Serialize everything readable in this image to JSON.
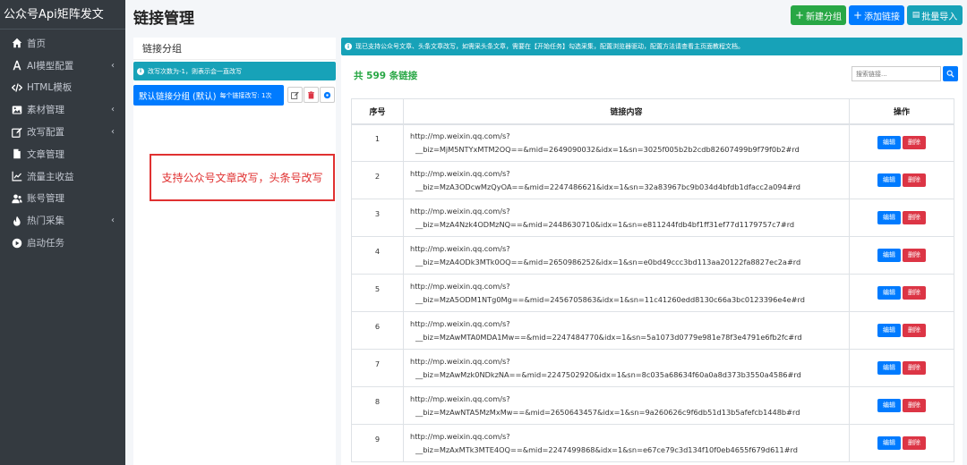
{
  "sidebar": {
    "brand": "公众号Api矩阵发文",
    "items": [
      {
        "label": "首页",
        "icon": "home-icon",
        "chevron": false
      },
      {
        "label": "AI模型配置",
        "icon": "ai-font-icon",
        "chevron": true
      },
      {
        "label": "HTML模板",
        "icon": "code-icon",
        "chevron": false
      },
      {
        "label": "素材管理",
        "icon": "image-icon",
        "chevron": true
      },
      {
        "label": "改写配置",
        "icon": "edit-icon",
        "chevron": true
      },
      {
        "label": "文章管理",
        "icon": "file-icon",
        "chevron": false
      },
      {
        "label": "流量主收益",
        "icon": "chart-line-icon",
        "chevron": false
      },
      {
        "label": "账号管理",
        "icon": "users-icon",
        "chevron": false
      },
      {
        "label": "热门采集",
        "icon": "fire-icon",
        "chevron": true
      },
      {
        "label": "启动任务",
        "icon": "play-circle-icon",
        "chevron": false
      }
    ]
  },
  "header": {
    "title": "链接管理",
    "buttons": {
      "new_group": "新建分组",
      "add_link": "添加链接",
      "bulk_import": "批量导入"
    }
  },
  "group_panel": {
    "title": "链接分组",
    "alert": "改写次数为-1，则表示会一直改写",
    "group": {
      "name": "默认链接分组 (默认)",
      "count_text": "每个链接改写: 1次"
    }
  },
  "annotation": "支持公众号文章改写，头条号改写",
  "main": {
    "alert": "现已支持公众号文章、头条文章改写，如需采头条文章，需要在【开始任务】勾选采集，配置浏览器驱动，配置方法请查看主页面教程文档。",
    "count": "共 599 条链接",
    "search_placeholder": "搜索链接...",
    "table": {
      "headers": [
        "序号",
        "链接内容",
        "操作"
      ],
      "edit_label": "编辑",
      "delete_label": "删除",
      "rows": [
        {
          "no": "1",
          "line1": "http://mp.weixin.qq.com/s?",
          "line2": "__biz=MjM5NTYxMTM2OQ==&mid=2649090032&idx=1&sn=3025f005b2b2cdb82607499b9f79f0b2#rd"
        },
        {
          "no": "2",
          "line1": "http://mp.weixin.qq.com/s?",
          "line2": "__biz=MzA3ODcwMzQyOA==&mid=2247486621&idx=1&sn=32a83967bc9b034d4bfdb1dfacc2a094#rd"
        },
        {
          "no": "3",
          "line1": "http://mp.weixin.qq.com/s?",
          "line2": "__biz=MzA4Nzk4ODMzNQ==&mid=2448630710&idx=1&sn=e811244fdb4bf1ff31ef77d1179757c7#rd"
        },
        {
          "no": "4",
          "line1": "http://mp.weixin.qq.com/s?",
          "line2": "__biz=MzA4ODk3MTk0OQ==&mid=2650986252&idx=1&sn=e0bd49ccc3bd113aa20122fa8827ec2a#rd"
        },
        {
          "no": "5",
          "line1": "http://mp.weixin.qq.com/s?",
          "line2": "__biz=MzA5ODM1NTg0Mg==&mid=2456705863&idx=1&sn=11c41260edd8130c66a3bc0123396e4e#rd"
        },
        {
          "no": "6",
          "line1": "http://mp.weixin.qq.com/s?",
          "line2": "__biz=MzAwMTA0MDA1Mw==&mid=2247484770&idx=1&sn=5a1073d0779e981e78f3e4791e6fb2fc#rd"
        },
        {
          "no": "7",
          "line1": "http://mp.weixin.qq.com/s?",
          "line2": "__biz=MzAwMzk0NDkzNA==&mid=2247502920&idx=1&sn=8c035a68634f60a0a8d373b3550a4586#rd"
        },
        {
          "no": "8",
          "line1": "http://mp.weixin.qq.com/s?",
          "line2": "__biz=MzAwNTA5MzMxMw==&mid=2650643457&idx=1&sn=9a260626c9f6db51d13b5afefcb1448b#rd"
        },
        {
          "no": "9",
          "line1": "http://mp.weixin.qq.com/s?",
          "line2": "__biz=MzAxMTk3MTE4OQ==&mid=2247499868&idx=1&sn=e67ce79c3d134f10f0eb4655f679d611#rd"
        }
      ]
    }
  },
  "colors": {
    "sidebar_bg": "#343a40",
    "primary": "#007bff",
    "success": "#28a745",
    "info": "#17a2b8",
    "danger": "#dc3545",
    "annotation": "#e03131"
  }
}
